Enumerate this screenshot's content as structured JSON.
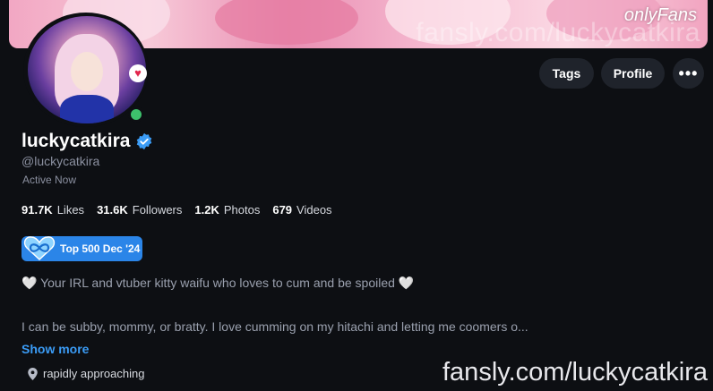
{
  "banner": {
    "watermark": "fansly.com/luckycatkira",
    "logo_text": "onlyFans"
  },
  "header": {
    "tags_label": "Tags",
    "profile_label": "Profile",
    "more_label": "•••"
  },
  "profile": {
    "display_name": "luckycatkira",
    "handle": "@luckycatkira",
    "status": "Active Now",
    "heart_icon": "♥"
  },
  "stats": [
    {
      "value": "91.7K",
      "label": "Likes"
    },
    {
      "value": "31.6K",
      "label": "Followers"
    },
    {
      "value": "1.2K",
      "label": "Photos"
    },
    {
      "value": "679",
      "label": "Videos"
    }
  ],
  "badge": {
    "label": "Top 500 Dec '24"
  },
  "bio": {
    "line1": "🤍 Your IRL and vtuber kitty waifu who loves to cum and be spoiled 🤍",
    "line2": "I can be subby, mommy, or bratty. I love cumming on my hitachi and letting me coomers o...",
    "show_more": "Show more"
  },
  "location": "rapidly approaching",
  "watermark": "fansly.com/luckycatkira",
  "colors": {
    "background": "#0d0f13",
    "accent": "#3b9cf6",
    "badge": "#2b85e8",
    "online": "#3dc06c"
  }
}
